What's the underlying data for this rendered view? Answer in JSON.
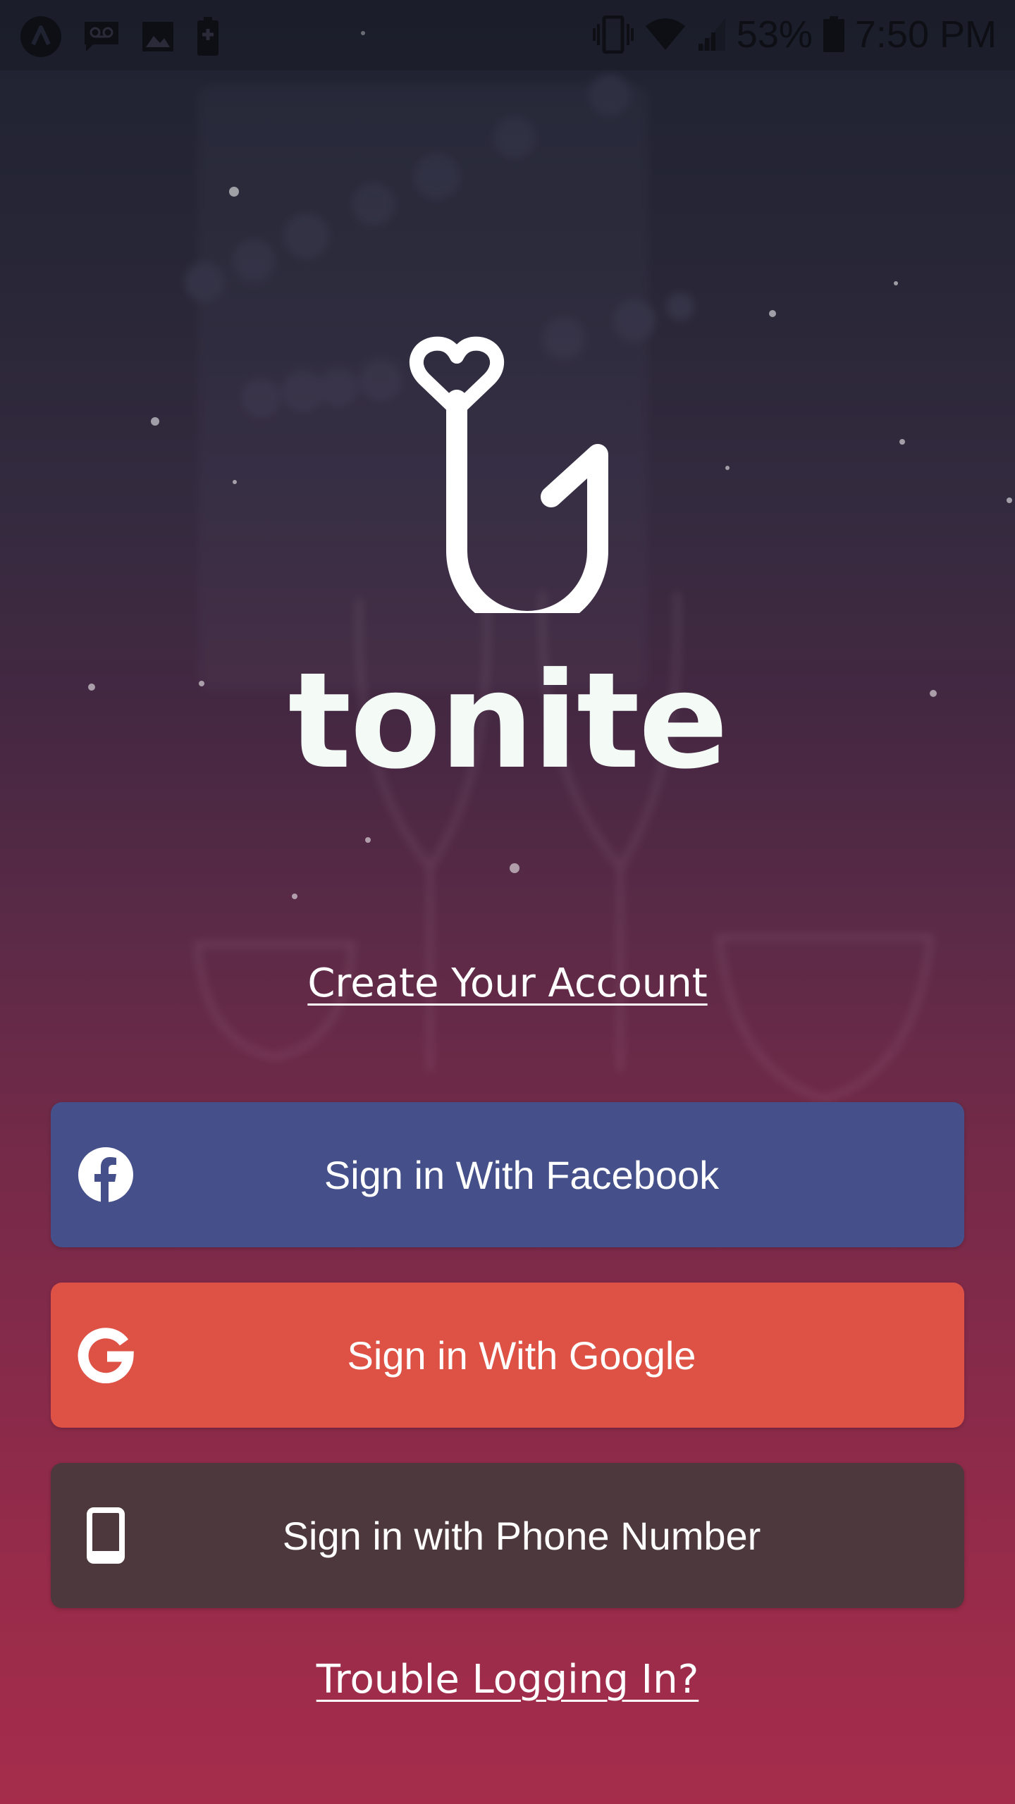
{
  "status_bar": {
    "battery_percent": "53%",
    "time": "7:50 PM",
    "icons": [
      "app-launcher-icon",
      "voicemail-icon",
      "image-icon",
      "battery-saver-icon",
      "vibrate-icon",
      "wifi-icon",
      "signal-icon",
      "battery-icon"
    ]
  },
  "brand": {
    "name": "tonite",
    "logo_icon": "heart-hook-logo"
  },
  "links": {
    "create_account": "Create Your Account",
    "trouble": "Trouble Logging In?"
  },
  "buttons": {
    "facebook": {
      "label": "Sign in With Facebook",
      "icon": "facebook-icon",
      "color": "#45508a"
    },
    "google": {
      "label": "Sign in With Google",
      "icon": "google-icon",
      "color": "#de5145"
    },
    "phone": {
      "label": "Sign in with Phone Number",
      "icon": "phone-icon",
      "color": "#4c383d"
    }
  },
  "colors": {
    "background_top": "#1f2231",
    "background_bottom": "#a52d4b",
    "brand_text": "#f4fbf6"
  }
}
